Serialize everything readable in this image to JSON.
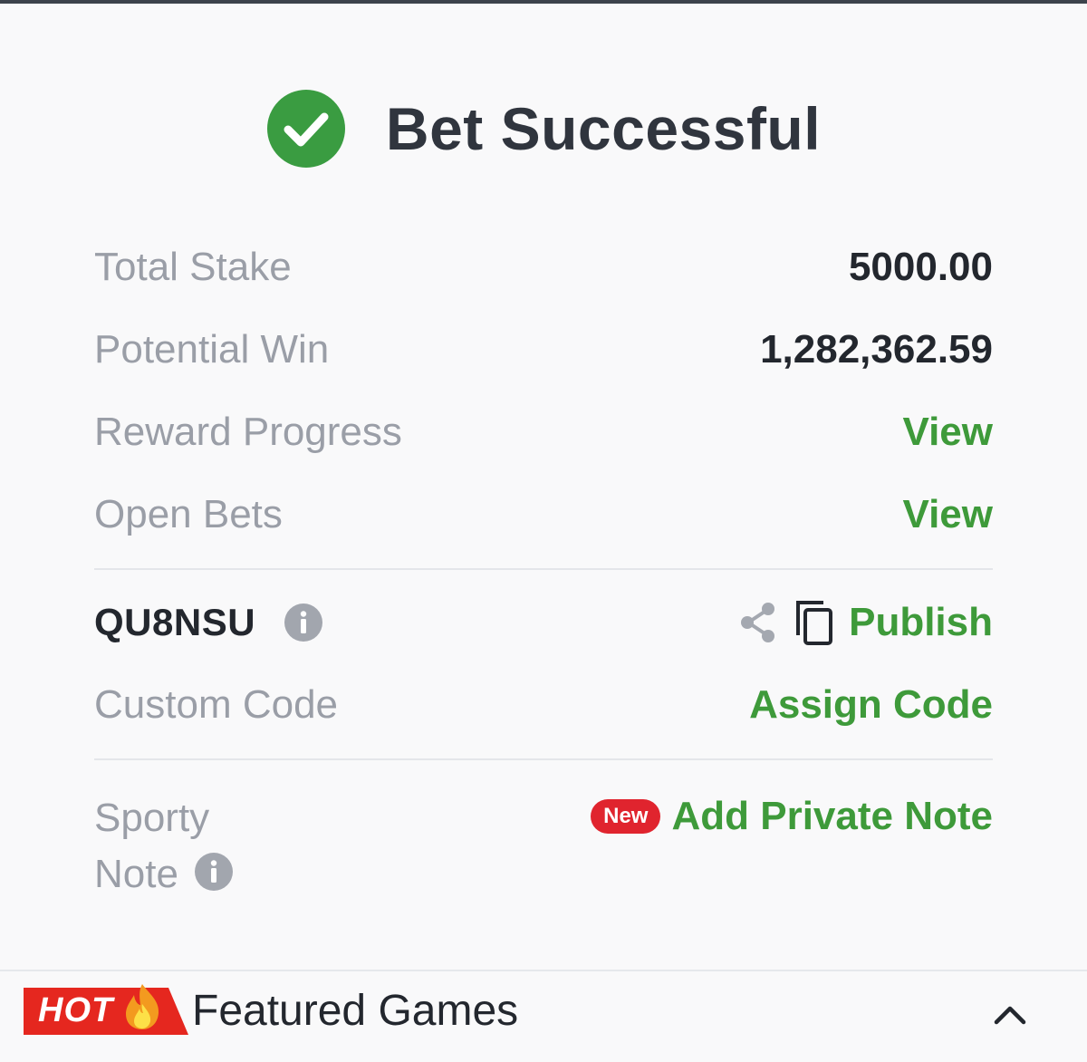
{
  "header": {
    "title": "Bet Successful",
    "icon": "check-circle-icon",
    "icon_color": "#3a9c41"
  },
  "summary": {
    "total_stake_label": "Total Stake",
    "total_stake_value": "5000.00",
    "potential_win_label": "Potential Win",
    "potential_win_value": "1,282,362.59",
    "reward_progress_label": "Reward Progress",
    "reward_progress_link": "View",
    "open_bets_label": "Open Bets",
    "open_bets_link": "View"
  },
  "booking": {
    "code": "QU8NSU",
    "publish_label": "Publish",
    "custom_code_label": "Custom Code",
    "assign_code_label": "Assign Code"
  },
  "note": {
    "label": "Sporty Note",
    "new_badge": "New",
    "add_note_label": "Add Private Note"
  },
  "footer": {
    "hot_badge": "HOT",
    "featured_title": "Featured Games"
  },
  "colors": {
    "accent_green": "#3e9a3a",
    "badge_red": "#e0242e",
    "hot_red": "#e5271f"
  }
}
